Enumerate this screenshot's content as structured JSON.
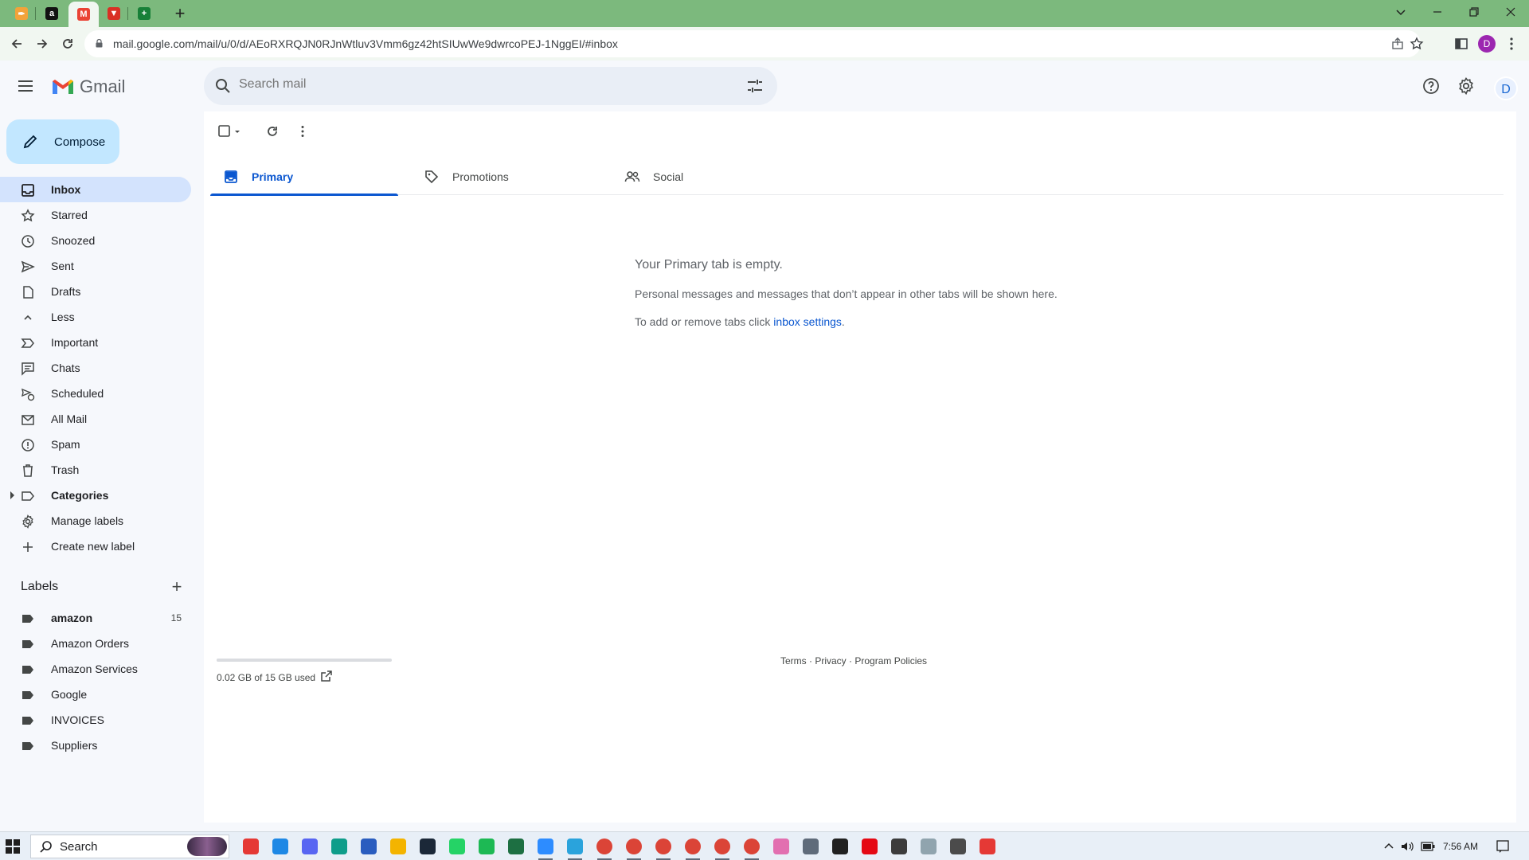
{
  "browser": {
    "tabs": [
      {
        "name": "tab-app-1",
        "color": "#f2a33a",
        "glyph": "✒"
      },
      {
        "name": "tab-amazon",
        "color": "#111111",
        "glyph": "a"
      },
      {
        "name": "tab-gmail",
        "color": "#ea4335",
        "glyph": "M",
        "active": true
      },
      {
        "name": "tab-app-4",
        "color": "#d93025",
        "glyph": "▼"
      },
      {
        "name": "tab-sheets",
        "color": "#188038",
        "glyph": "+"
      }
    ],
    "url": "mail.google.com/mail/u/0/d/AEoRXRQJN0RJnWtluv3Vmm6gz42htSIUwWe9dwrcoPEJ-1NggEI/#inbox",
    "profile_initial": "D"
  },
  "gmail": {
    "logo_text": "Gmail",
    "search_placeholder": "Search mail",
    "account_initial": "D",
    "compose_label": "Compose",
    "nav": [
      {
        "label": "Inbox",
        "icon": "inbox-icon",
        "active": true
      },
      {
        "label": "Starred",
        "icon": "star-icon"
      },
      {
        "label": "Snoozed",
        "icon": "clock-icon"
      },
      {
        "label": "Sent",
        "icon": "send-icon"
      },
      {
        "label": "Drafts",
        "icon": "draft-icon"
      },
      {
        "label": "Less",
        "icon": "chevron-up-icon"
      },
      {
        "label": "Important",
        "icon": "important-icon"
      },
      {
        "label": "Chats",
        "icon": "chat-icon"
      },
      {
        "label": "Scheduled",
        "icon": "scheduled-icon"
      },
      {
        "label": "All Mail",
        "icon": "all-mail-icon"
      },
      {
        "label": "Spam",
        "icon": "spam-icon"
      },
      {
        "label": "Trash",
        "icon": "trash-icon"
      },
      {
        "label": "Categories",
        "icon": "label-outline-icon",
        "bold": true
      },
      {
        "label": "Manage labels",
        "icon": "settings-gear-icon"
      },
      {
        "label": "Create new label",
        "icon": "plus-icon"
      }
    ],
    "labels_heading": "Labels",
    "labels": [
      {
        "label": "amazon",
        "count": "15",
        "bold": true
      },
      {
        "label": "Amazon Orders"
      },
      {
        "label": "Amazon Services"
      },
      {
        "label": "Google"
      },
      {
        "label": "INVOICES"
      },
      {
        "label": "Suppliers"
      }
    ],
    "tabs": [
      {
        "label": "Primary",
        "icon": "inbox-tab-icon",
        "active": true
      },
      {
        "label": "Promotions",
        "icon": "tag-icon"
      },
      {
        "label": "Social",
        "icon": "people-icon"
      }
    ],
    "empty_state": {
      "title": "Your Primary tab is empty.",
      "description": "Personal messages and messages that don’t appear in other tabs will be shown here.",
      "settings_prefix": "To add or remove tabs click ",
      "settings_link": "inbox settings",
      "settings_suffix": "."
    },
    "storage": {
      "text": "0.02 GB of 15 GB used",
      "used_fraction": 0.0013
    },
    "footer": {
      "terms": "Terms",
      "privacy": "Privacy",
      "policies": "Program Policies",
      "sep": " · "
    }
  },
  "taskbar": {
    "search_label": "Search",
    "time": "7:56 AM",
    "apps": [
      {
        "name": "taskbar-red-app",
        "color": "#e53935"
      },
      {
        "name": "taskbar-mail-app",
        "color": "#1e88e5"
      },
      {
        "name": "taskbar-discord-app",
        "color": "#5865f2"
      },
      {
        "name": "taskbar-edge-app",
        "color": "#0f9d8a"
      },
      {
        "name": "taskbar-store-app",
        "color": "#2a5dbf"
      },
      {
        "name": "taskbar-explorer-app",
        "color": "#f4b400"
      },
      {
        "name": "taskbar-steam-app",
        "color": "#1b2838"
      },
      {
        "name": "taskbar-whatsapp-app",
        "color": "#25d366"
      },
      {
        "name": "taskbar-spotify-app",
        "color": "#1db954"
      },
      {
        "name": "taskbar-excel-app",
        "color": "#1d6f42"
      },
      {
        "name": "taskbar-zoom-app",
        "color": "#2d8cff"
      },
      {
        "name": "taskbar-telegram-app",
        "color": "#2aa3dc"
      },
      {
        "name": "taskbar-chrome-app-1",
        "color": "#db4437"
      },
      {
        "name": "taskbar-chrome-app-2",
        "color": "#db4437"
      },
      {
        "name": "taskbar-chrome-app-3",
        "color": "#db4437"
      },
      {
        "name": "taskbar-chrome-app-4",
        "color": "#db4437"
      },
      {
        "name": "taskbar-chrome-app-5",
        "color": "#db4437"
      },
      {
        "name": "taskbar-chrome-app-6",
        "color": "#db4437"
      },
      {
        "name": "taskbar-paint-app",
        "color": "#e26fb0"
      },
      {
        "name": "taskbar-calculator-app",
        "color": "#5f6b7a"
      },
      {
        "name": "taskbar-media-app",
        "color": "#212121"
      },
      {
        "name": "taskbar-netflix-app",
        "color": "#e50914"
      },
      {
        "name": "taskbar-sticky-app",
        "color": "#3c3c3c"
      },
      {
        "name": "taskbar-notepad-app",
        "color": "#90a4ae"
      },
      {
        "name": "taskbar-settings-app",
        "color": "#4b4b4b"
      },
      {
        "name": "taskbar-tool-app",
        "color": "#e53935"
      }
    ]
  }
}
